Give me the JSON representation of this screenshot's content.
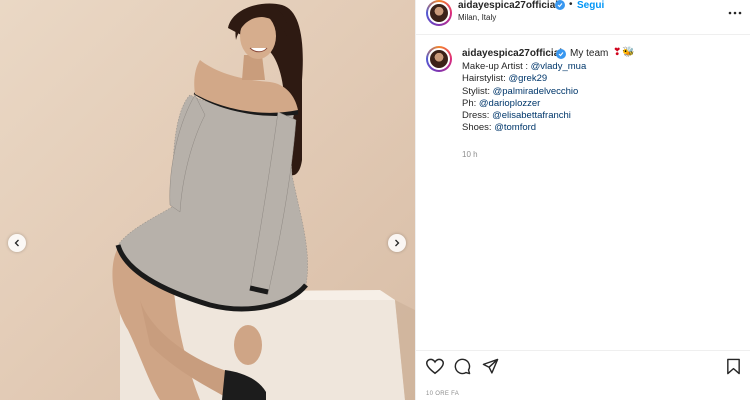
{
  "post": {
    "username": "aidayespica27official",
    "follow_label": "Segui",
    "separator": "•",
    "location": "Milan, Italy",
    "caption_main": "My team",
    "caption_emojis": [
      "❣",
      "🐝"
    ],
    "credits": [
      {
        "label": "Make-up Artist : ",
        "mention": "@vlady_mua"
      },
      {
        "label": "Hairstylist: ",
        "mention": "@grek29"
      },
      {
        "label": "Stylist: ",
        "mention": "@palmiradelvecchio"
      },
      {
        "label": "Ph: ",
        "mention": "@darioplozzer"
      },
      {
        "label": "Dress: ",
        "mention": "@elisabettafranchi"
      },
      {
        "label": "Shoes: ",
        "mention": "@tomford"
      }
    ],
    "caption_time": "10 h",
    "post_time": "10 ORE FA"
  },
  "icons": {
    "more": "more-horizontal-icon",
    "like": "heart-icon",
    "comment": "comment-icon",
    "share": "send-icon",
    "save": "bookmark-icon",
    "verified": "verified-badge-icon",
    "prev": "chevron-left-icon",
    "next": "chevron-right-icon"
  },
  "colors": {
    "link_blue": "#0095f6",
    "mention": "#00376b",
    "verified": "#3897f0",
    "muted": "#8e8e8e",
    "photo_bg": "#e3ccb7"
  }
}
